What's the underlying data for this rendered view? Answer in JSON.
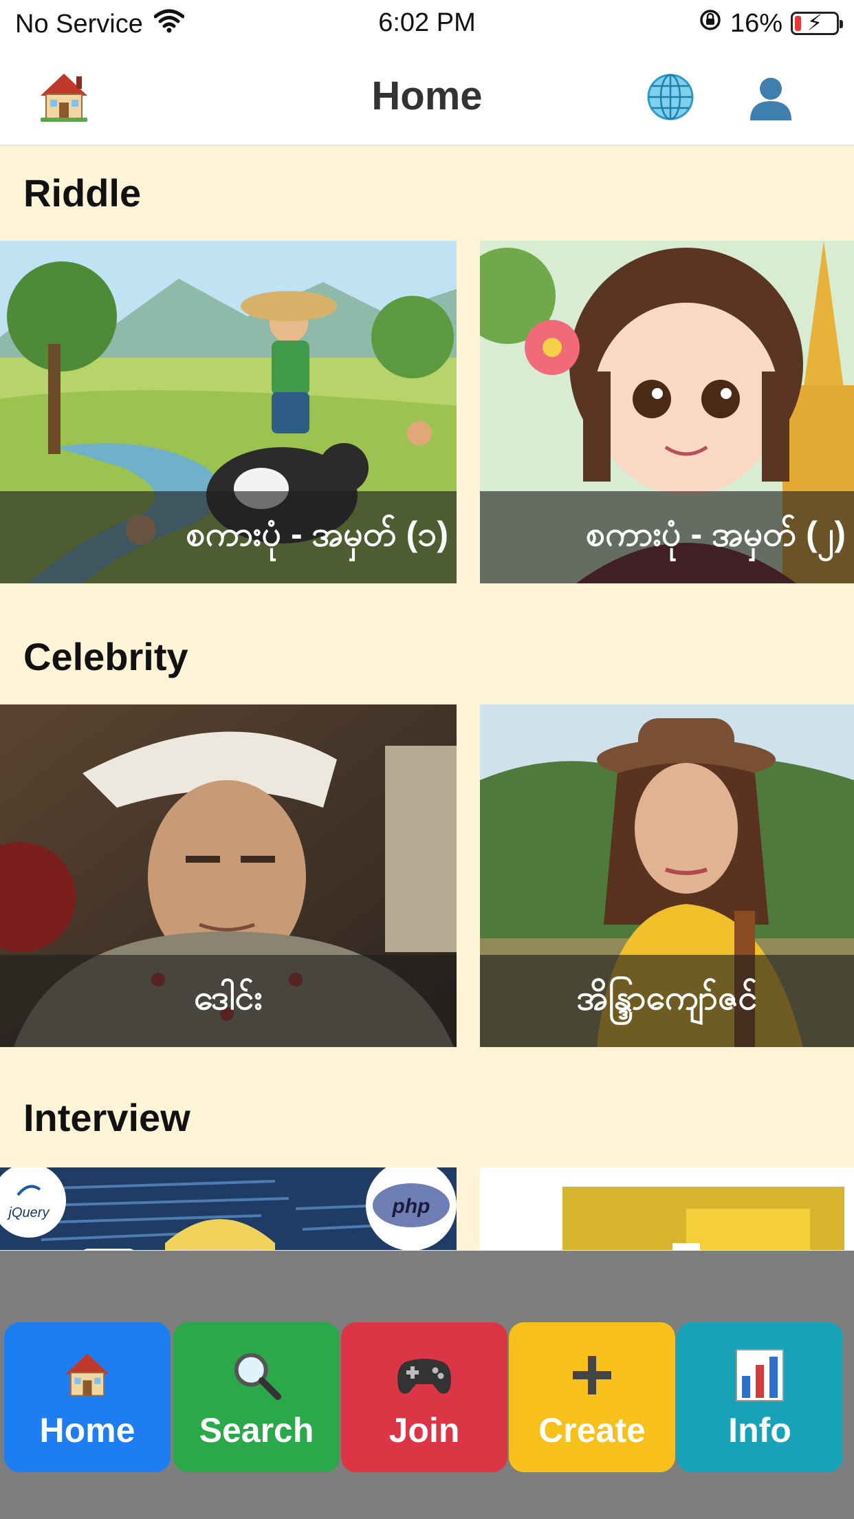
{
  "status_bar": {
    "carrier": "No Service",
    "time": "6:02 PM",
    "battery": "16%",
    "battery_level": 0.16
  },
  "nav": {
    "title": "Home",
    "left_icon": "house-icon",
    "right_icons": [
      "globe-icon",
      "user-icon"
    ]
  },
  "sections": [
    {
      "title": "Riddle",
      "cards": [
        {
          "caption": "စကားပုံ - အမှတ် (၁)",
          "image": "village-boy-on-buffalo-illustration"
        },
        {
          "caption": "စကားပုံ - အမှတ် (၂)",
          "image": "girl-with-flower-pagoda-illustration"
        }
      ]
    },
    {
      "title": "Celebrity",
      "cards": [
        {
          "caption": "ဒေါင်း",
          "image": "man-in-traditional-headdress-photo"
        },
        {
          "caption": "အိန္ဒြာကျော်ဇင်",
          "image": "woman-in-hat-photo"
        }
      ]
    },
    {
      "title": "Interview",
      "cards": [
        {
          "caption": "",
          "image": "web-dev-programmer-illustration"
        },
        {
          "caption": "",
          "image": "yellow-document-icon-illustration"
        }
      ]
    }
  ],
  "tabs": [
    {
      "label": "Home",
      "icon": "house-icon",
      "color": "#1e7df0"
    },
    {
      "label": "Search",
      "icon": "magnifier-icon",
      "color": "#2aa84a"
    },
    {
      "label": "Join",
      "icon": "gamepad-icon",
      "color": "#dc3545"
    },
    {
      "label": "Create",
      "icon": "plus-icon",
      "color": "#f7c01b"
    },
    {
      "label": "Info",
      "icon": "bar-chart-icon",
      "color": "#17a2b8"
    }
  ],
  "logos": {
    "jquery": "jQuery",
    "php": "php"
  }
}
